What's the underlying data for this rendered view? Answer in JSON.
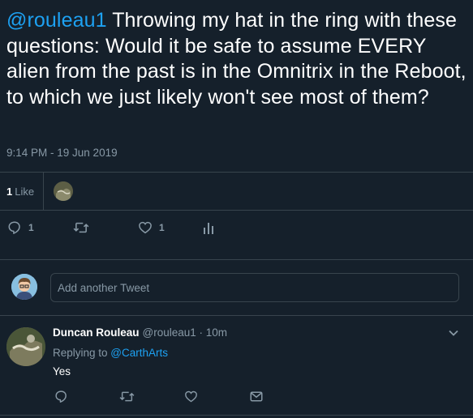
{
  "tweet": {
    "mention": "@rouleau1",
    "body": " Throwing my hat in the ring with these questions: Would it be safe to assume EVERY alien from the past is in the Omnitrix in the Reboot, to which we just likely won't see most of them?",
    "timestamp": "9:14 PM - 19 Jun 2019",
    "likes_count": "1",
    "likes_label": "Like",
    "reply_count": "1",
    "like_count": "1"
  },
  "composer": {
    "placeholder": "Add another Tweet"
  },
  "reply": {
    "name": "Duncan Rouleau",
    "meta": "@rouleau1 · 10m",
    "replying_prefix": "Replying to ",
    "replying_handle": "@CarthArts",
    "text": "Yes"
  },
  "colors": {
    "background": "#15202b",
    "accent": "#1da1f2",
    "muted": "#8899a6",
    "divider": "#38444d"
  },
  "icons": {
    "reply": "reply-icon",
    "retweet": "retweet-icon",
    "like": "heart-icon",
    "analytics": "analytics-icon",
    "dm": "message-icon",
    "caret": "chevron-down-icon"
  }
}
